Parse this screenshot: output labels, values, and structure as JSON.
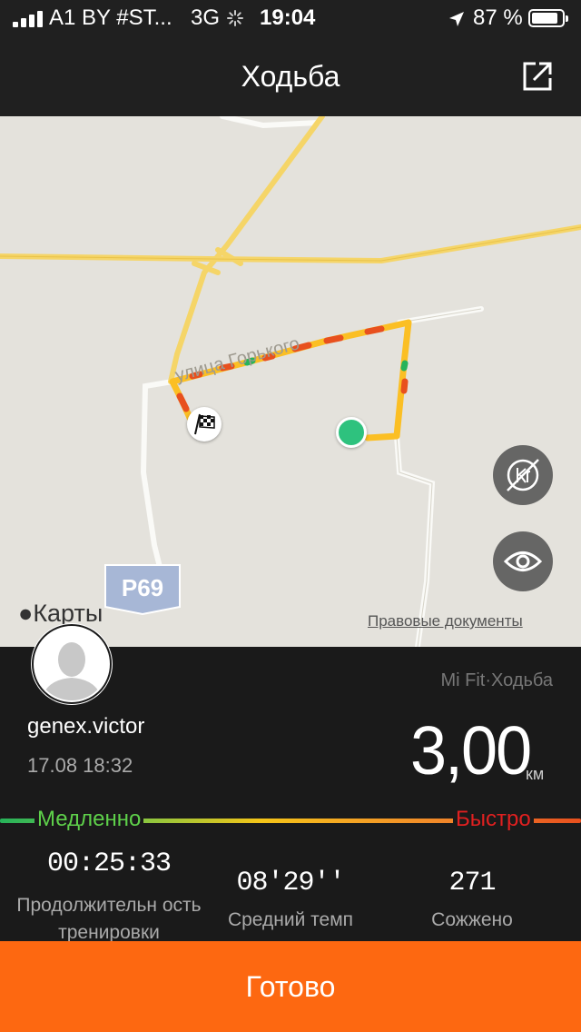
{
  "status_bar": {
    "carrier": "A1 BY #ST...",
    "network": "3G",
    "time": "19:04",
    "battery": "87 %",
    "icons": [
      "signal-icon",
      "loading-icon",
      "location-arrow-icon",
      "battery-icon"
    ]
  },
  "header": {
    "title": "Ходьба",
    "share_icon": "share-icon"
  },
  "map": {
    "street_label": "улица Горького",
    "road_badge": "Р69",
    "logo_text": "Карты",
    "legal_link": "Правовые документы",
    "buttons": [
      "hide-pace-icon",
      "eye-icon"
    ],
    "colors": {
      "route_main": "#fbbf24",
      "route_slow": "#e8501e",
      "start": "#2ec27e"
    }
  },
  "workout": {
    "username": "genex.victor",
    "datetime": "17.08 18:32",
    "source": "Mi Fit·Ходьба",
    "distance": "3,00",
    "distance_unit": "км",
    "slow_label": "Медленно",
    "fast_label": "Быстро",
    "stats": [
      {
        "value": "00:25:33",
        "label": "Продолжительн ость тренировки"
      },
      {
        "value": "08'29''",
        "label": "Средний темп"
      },
      {
        "value": "271",
        "label": "Сожжено"
      }
    ]
  },
  "footer": {
    "done_label": "Готово",
    "accent_color": "#fd6811"
  }
}
